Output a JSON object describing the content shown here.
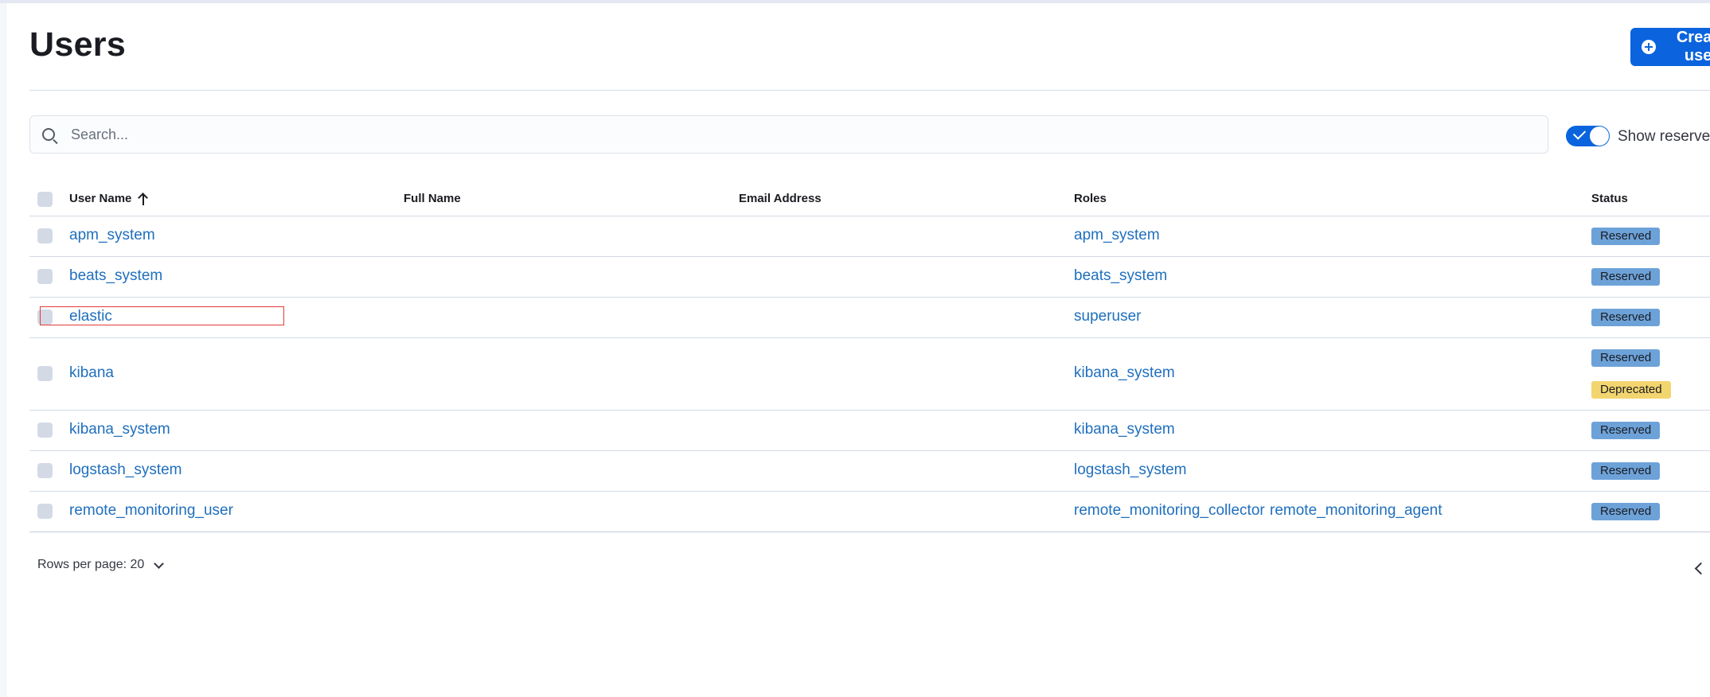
{
  "page": {
    "title": "Users",
    "create_button_label": "Create user"
  },
  "search": {
    "placeholder": "Search..."
  },
  "filter": {
    "show_reserved_label": "Show reserved users",
    "show_reserved_checked": true
  },
  "table": {
    "columns": [
      "User Name",
      "Full Name",
      "Email Address",
      "Roles",
      "Status"
    ],
    "sort": {
      "column": "User Name",
      "direction": "ascending"
    },
    "rows": [
      {
        "username": "apm_system",
        "full_name": "",
        "email": "",
        "roles": [
          "apm_system"
        ],
        "status": [
          "Reserved"
        ]
      },
      {
        "username": "beats_system",
        "full_name": "",
        "email": "",
        "roles": [
          "beats_system"
        ],
        "status": [
          "Reserved"
        ]
      },
      {
        "username": "elastic",
        "full_name": "",
        "email": "",
        "roles": [
          "superuser"
        ],
        "status": [
          "Reserved"
        ]
      },
      {
        "username": "kibana",
        "full_name": "",
        "email": "",
        "roles": [
          "kibana_system"
        ],
        "status": [
          "Reserved",
          "Deprecated"
        ]
      },
      {
        "username": "kibana_system",
        "full_name": "",
        "email": "",
        "roles": [
          "kibana_system"
        ],
        "status": [
          "Reserved"
        ]
      },
      {
        "username": "logstash_system",
        "full_name": "",
        "email": "",
        "roles": [
          "logstash_system"
        ],
        "status": [
          "Reserved"
        ]
      },
      {
        "username": "remote_monitoring_user",
        "full_name": "",
        "email": "",
        "roles": [
          "remote_monitoring_collector",
          "remote_monitoring_agent"
        ],
        "status": [
          "Reserved"
        ]
      }
    ]
  },
  "pagination": {
    "rows_per_page_label": "Rows per page: 20"
  },
  "colors": {
    "primary": "#0b64dd",
    "link": "#1f6fbd",
    "badge_reserved": "#6da2d9",
    "badge_deprecated": "#f3d56f",
    "annotation_outline": "#e23a3a"
  }
}
